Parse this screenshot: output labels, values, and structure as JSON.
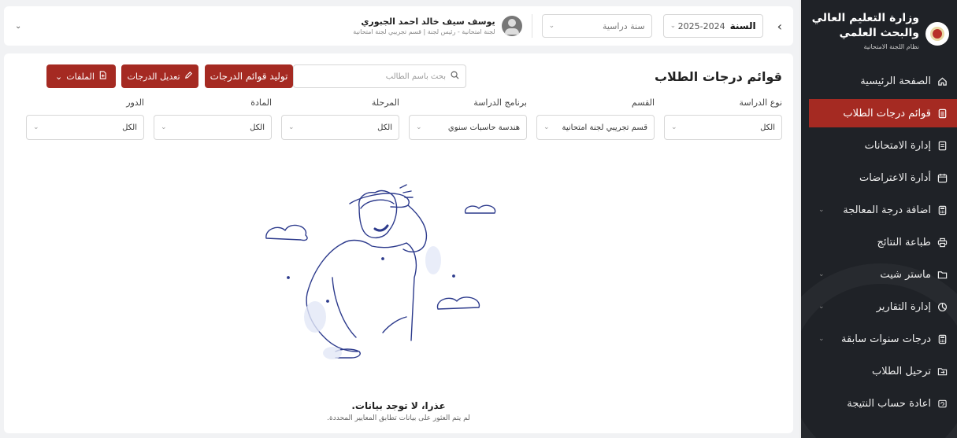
{
  "sidebar": {
    "brand_title_line1": "وزارة التعليم العالي",
    "brand_title_line2": "والبحث العلمي",
    "brand_sub": "نظام اللجنة الامتحانية",
    "items": [
      {
        "label": "الصفحة الرئيسية",
        "icon": "home-icon"
      },
      {
        "label": "قوائم درجات الطلاب",
        "icon": "grade-list-icon"
      },
      {
        "label": "إدارة الامتحانات",
        "icon": "exam-icon"
      },
      {
        "label": "أدارة الاعتراضات",
        "icon": "calendar-icon"
      },
      {
        "label": "اضافة درجة المعالجة",
        "icon": "calculator-icon"
      },
      {
        "label": "طباعة النتائج",
        "icon": "printer-icon"
      },
      {
        "label": "ماستر شيت",
        "icon": "folder-icon"
      },
      {
        "label": "إدارة التقارير",
        "icon": "pie-chart-icon"
      },
      {
        "label": "درجات سنوات سابقة",
        "icon": "calculator-icon"
      },
      {
        "label": "ترحيل الطلاب",
        "icon": "transfer-icon"
      },
      {
        "label": "اعادة حساب النتيجة",
        "icon": "recalc-icon"
      }
    ],
    "active_color": "#a52a22"
  },
  "topbar": {
    "year_label": "السنة",
    "year_value": "2024-2025",
    "study_year_placeholder": "سنة دراسية",
    "user_name": "يوسف سيف خالد احمد الجبوري",
    "user_role": "لجنة امتحانية - رئيس لجنة | قسم تجريبي لجنة امتحانية"
  },
  "main": {
    "title": "قوائم درجات الطلاب",
    "search_placeholder": "بحث باسم الطالب",
    "generate_button": "توليد قوائم الدرجات",
    "edit_button": "تعديل الدرجات",
    "files_button": "الملفات"
  },
  "filters": [
    {
      "label": "نوع الدراسة",
      "value": "الكل"
    },
    {
      "label": "القسم",
      "value": "قسم تجريبي لجنة امتحانية"
    },
    {
      "label": "برنامج الدراسة",
      "value": "هندسة حاسبات سنوي"
    },
    {
      "label": "المرحلة",
      "value": "الكل"
    },
    {
      "label": "المادة",
      "value": "الكل"
    },
    {
      "label": "الدور",
      "value": "الكل"
    }
  ],
  "empty_state": {
    "title": "عذرا، لا توجد بيانات.",
    "subtitle": "لم يتم العثور على بيانات تطابق المعايير المحددة."
  }
}
